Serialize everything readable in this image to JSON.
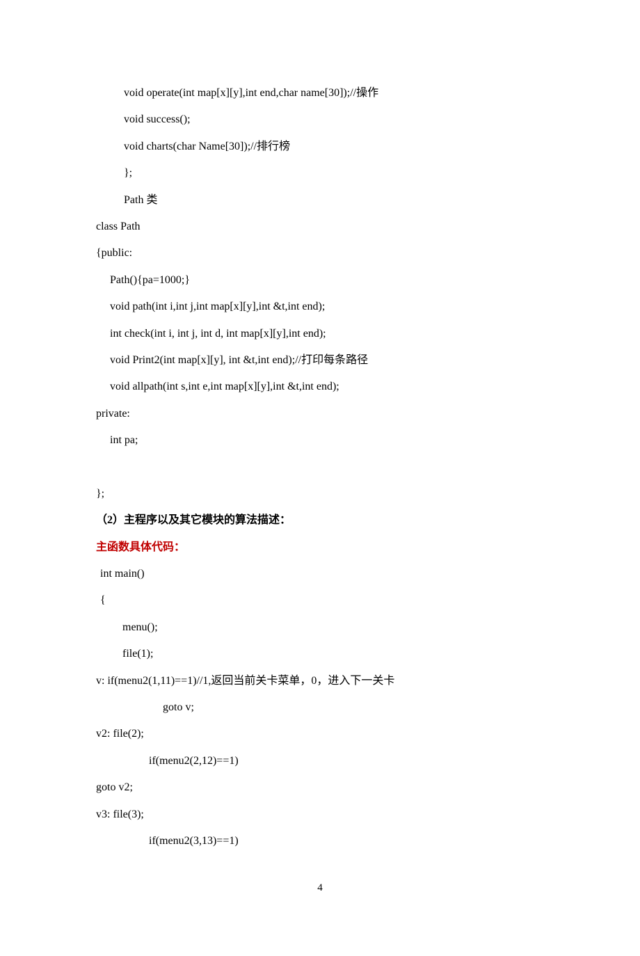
{
  "lines": {
    "l1": "void operate(int map[x][y],int end,char name[30]);//操作",
    "l2": "void success();",
    "l3": "void charts(char Name[30]);//排行榜",
    "l4": "};",
    "l5": "Path 类",
    "l6": "class Path",
    "l7": "{public:",
    "l8": "Path(){pa=1000;}",
    "l9": "void path(int i,int j,int map[x][y],int &t,int end);",
    "l10": "int check(int i, int j, int d, int map[x][y],int end);",
    "l11": "void Print2(int map[x][y], int &t,int end);//打印每条路径",
    "l12": "void allpath(int s,int e,int map[x][y],int &t,int end);",
    "l13": "private:",
    "l14": "int pa;",
    "l15": "};",
    "h1": "（2）主程序以及其它模块的算法描述：",
    "h2": "主函数具体代码：",
    "c1": "int main()",
    "c2": "{",
    "c3": "menu();",
    "c4": "file(1);",
    "c5": "v:  if(menu2(1,11)==1)//1,返回当前关卡菜单，0，进入下一关卡",
    "c6": "goto v;",
    "c7": "v2:      file(2);",
    "c8": "if(menu2(2,12)==1)",
    "c9": "goto v2;",
    "c10": "v3:      file(3);",
    "c11": "if(menu2(3,13)==1)"
  },
  "pageNumber": "4"
}
